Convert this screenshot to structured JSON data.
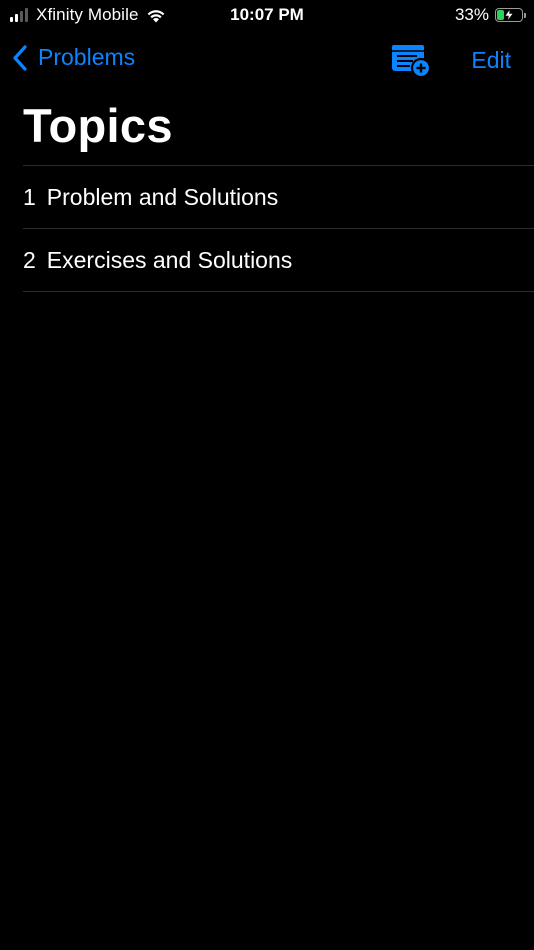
{
  "status_bar": {
    "carrier": "Xfinity Mobile",
    "time": "10:07 PM",
    "battery_percent": "33%",
    "battery_level": 0.33,
    "signal_bars": 2,
    "signal_total": 4
  },
  "nav": {
    "back_label": "Problems",
    "edit_label": "Edit",
    "add_icon": "list-add-icon"
  },
  "page": {
    "title": "Topics"
  },
  "topics": [
    {
      "number": "1",
      "label": "Problem and Solutions"
    },
    {
      "number": "2",
      "label": "Exercises and Solutions"
    }
  ],
  "colors": {
    "background": "#000000",
    "accent": "#0a84ff",
    "separator": "#2c2c2e",
    "battery_charging": "#30d158",
    "text": "#ffffff"
  }
}
